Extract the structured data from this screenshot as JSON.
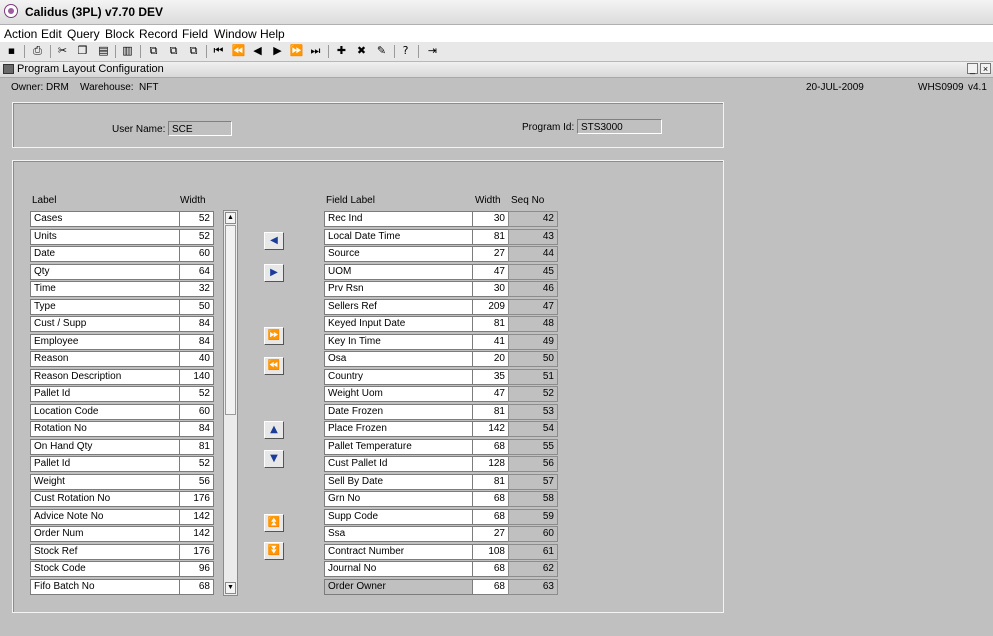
{
  "window": {
    "title": "Calidus (3PL) v7.70 DEV"
  },
  "menu": [
    "Action",
    "Edit",
    "Query",
    "Block",
    "Record",
    "Field",
    "Window",
    "Help"
  ],
  "toolbar_icons": [
    "save-icon",
    "print-icon",
    "cut-icon",
    "copy-icon",
    "paste-icon",
    "clear-icon",
    "duplicate-icon",
    "copy-record-icon",
    "paste-record-icon",
    "first-record-icon",
    "previous-set-icon",
    "previous-record-icon",
    "next-record-icon",
    "next-set-icon",
    "last-record-icon",
    "insert-record-icon",
    "delete-record-icon",
    "clear-record-icon",
    "help-icon",
    "exit-icon"
  ],
  "form": {
    "title": "Program Layout Configuration",
    "minimize": "_",
    "close": "×"
  },
  "status": {
    "owner_label": "Owner:",
    "owner": "DRM",
    "warehouse_label": "Warehouse:",
    "warehouse": "NFT",
    "date": "20-JUL-2009",
    "form_code": "WHS0909",
    "version": "v4.1"
  },
  "header": {
    "user_label": "User Name:",
    "user_value": "SCE",
    "program_label": "Program Id:",
    "program_value": "STS3000"
  },
  "left_table": {
    "headers": {
      "label": "Label",
      "width": "Width"
    },
    "rows": [
      {
        "label": "Cases",
        "width": "52"
      },
      {
        "label": "Units",
        "width": "52"
      },
      {
        "label": "Date",
        "width": "60"
      },
      {
        "label": "Qty",
        "width": "64"
      },
      {
        "label": "Time",
        "width": "32"
      },
      {
        "label": "Type",
        "width": "50"
      },
      {
        "label": "Cust / Supp",
        "width": "84"
      },
      {
        "label": "Employee",
        "width": "84"
      },
      {
        "label": "Reason",
        "width": "40"
      },
      {
        "label": "Reason Description",
        "width": "140"
      },
      {
        "label": "Pallet Id",
        "width": "52"
      },
      {
        "label": "Location Code",
        "width": "60"
      },
      {
        "label": "Rotation No",
        "width": "84"
      },
      {
        "label": "On Hand Qty",
        "width": "81"
      },
      {
        "label": "Pallet Id",
        "width": "52"
      },
      {
        "label": "Weight",
        "width": "56"
      },
      {
        "label": "Cust Rotation No",
        "width": "176"
      },
      {
        "label": "Advice Note No",
        "width": "142"
      },
      {
        "label": "Order Num",
        "width": "142"
      },
      {
        "label": "Stock Ref",
        "width": "176"
      },
      {
        "label": "Stock Code",
        "width": "96"
      },
      {
        "label": "Fifo Batch No",
        "width": "68"
      }
    ]
  },
  "right_table": {
    "headers": {
      "label": "Field Label",
      "width": "Width",
      "seq": "Seq No"
    },
    "rows": [
      {
        "label": "Rec Ind",
        "width": "30",
        "seq": "42"
      },
      {
        "label": "Local Date Time",
        "width": "81",
        "seq": "43"
      },
      {
        "label": "Source",
        "width": "27",
        "seq": "44"
      },
      {
        "label": "UOM",
        "width": "47",
        "seq": "45"
      },
      {
        "label": "Prv Rsn",
        "width": "30",
        "seq": "46"
      },
      {
        "label": "Sellers Ref",
        "width": "209",
        "seq": "47"
      },
      {
        "label": "Keyed Input Date",
        "width": "81",
        "seq": "48"
      },
      {
        "label": "Key In Time",
        "width": "41",
        "seq": "49"
      },
      {
        "label": "Osa",
        "width": "20",
        "seq": "50"
      },
      {
        "label": "Country",
        "width": "35",
        "seq": "51"
      },
      {
        "label": "Weight Uom",
        "width": "47",
        "seq": "52"
      },
      {
        "label": "Date Frozen",
        "width": "81",
        "seq": "53"
      },
      {
        "label": "Place Frozen",
        "width": "142",
        "seq": "54"
      },
      {
        "label": "Pallet Temperature",
        "width": "68",
        "seq": "55"
      },
      {
        "label": "Cust Pallet Id",
        "width": "128",
        "seq": "56"
      },
      {
        "label": "Sell By Date",
        "width": "81",
        "seq": "57"
      },
      {
        "label": "Grn No",
        "width": "68",
        "seq": "58"
      },
      {
        "label": "Supp Code",
        "width": "68",
        "seq": "59"
      },
      {
        "label": "Ssa",
        "width": "27",
        "seq": "60"
      },
      {
        "label": "Contract Number",
        "width": "108",
        "seq": "61"
      },
      {
        "label": "Journal No",
        "width": "68",
        "seq": "62"
      },
      {
        "label": "Order Owner",
        "width": "68",
        "seq": "63"
      }
    ]
  },
  "action_buttons": [
    {
      "name": "move-left-button",
      "icon": "◀"
    },
    {
      "name": "move-right-button",
      "icon": "▶"
    },
    {
      "name": "move-all-right-button",
      "icon": "⏩"
    },
    {
      "name": "move-all-left-button",
      "icon": "⏪"
    },
    {
      "name": "move-up-button",
      "icon": "▲"
    },
    {
      "name": "move-down-button",
      "icon": "▼"
    },
    {
      "name": "move-top-button",
      "icon": "⏫"
    },
    {
      "name": "move-bottom-button",
      "icon": "⏬"
    }
  ],
  "scroll_icons": {
    "up": "▲",
    "down": "▼"
  }
}
